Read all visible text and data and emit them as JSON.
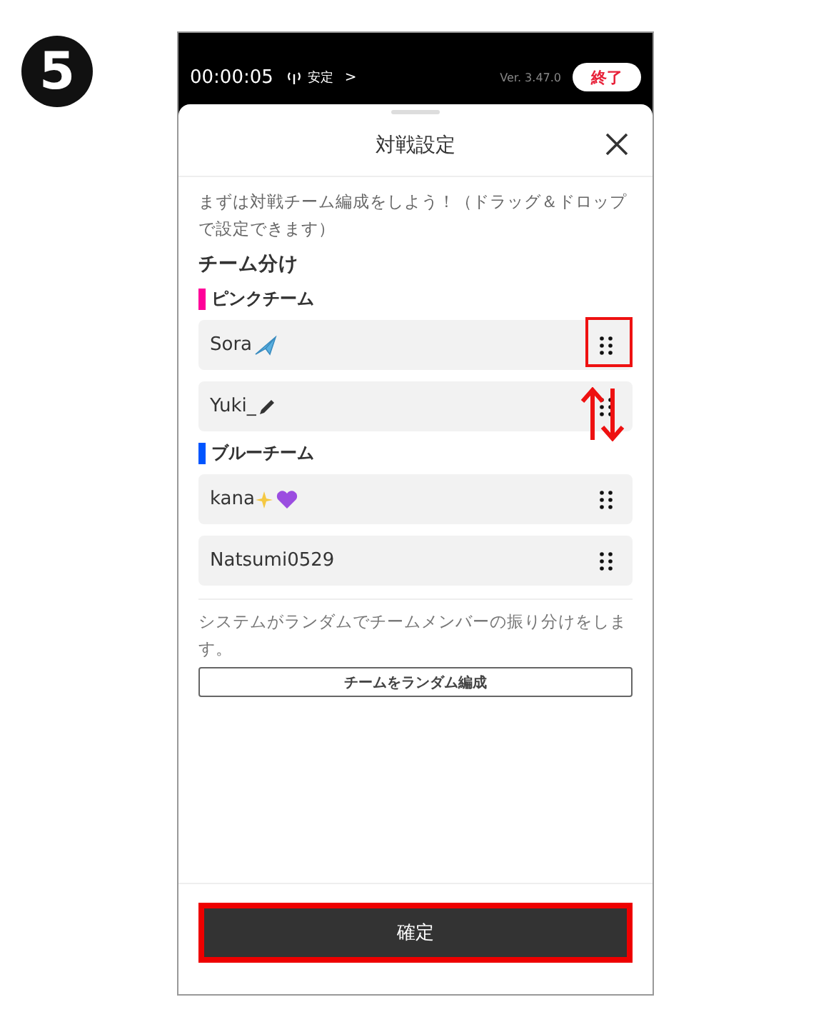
{
  "step_badge": "5",
  "status_bar": {
    "time": "00:00:05",
    "connection": "安定",
    "chevron": ">",
    "version": "Ver. 3.47.0",
    "end_button": "終了"
  },
  "sheet": {
    "title": "対戦設定",
    "intro": "まずは対戦チーム編成をしよう！（ドラッグ＆ドロップで設定できます）",
    "section_title": "チーム分け",
    "teams": [
      {
        "name": "ピンクチーム",
        "color": "#ff0099",
        "members": [
          {
            "name": "Sora",
            "kind": "airplane",
            "highlighted": true,
            "swap_arrows": false
          },
          {
            "name": "Yuki_",
            "kind": "pencil",
            "highlighted": false,
            "swap_arrows": true
          }
        ]
      },
      {
        "name": "ブルーチーム",
        "color": "#0055ff",
        "members": [
          {
            "name": "kana",
            "kind": "sparkle-heart",
            "highlighted": false,
            "swap_arrows": false
          },
          {
            "name": "Natsumi0529",
            "kind": "plain",
            "highlighted": false,
            "swap_arrows": false
          }
        ]
      }
    ],
    "random_note": "システムがランダムでチームメンバーの振り分けをします。",
    "random_button": "チームをランダム編成",
    "confirm_button": {
      "label": "確定",
      "highlighted": true
    }
  }
}
